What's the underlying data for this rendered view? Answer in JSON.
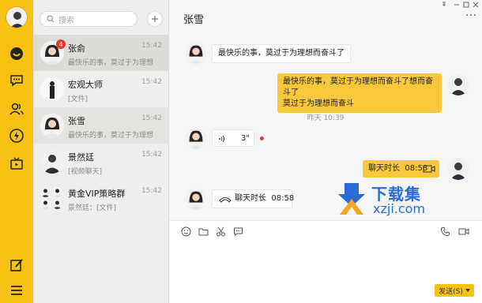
{
  "search": {
    "placeholder": "搜索"
  },
  "contacts": [
    {
      "name": "张俞",
      "time": "15:42",
      "preview": "最快乐的事，莫过于为理想",
      "badge": "4"
    },
    {
      "name": "宏观大师",
      "time": "15:42",
      "preview": "[文件]"
    },
    {
      "name": "张雪",
      "time": "15:42",
      "preview": "最快乐的事，莫过于为理想"
    },
    {
      "name": "景然廷",
      "time": "15:42",
      "preview": "[视频聊天]"
    },
    {
      "name": "黄金VIP策略群",
      "time": "15:42",
      "preview": "景然廷：[文件]"
    }
  ],
  "chat": {
    "title": "张雪",
    "messages": [
      {
        "dir": "in",
        "text": "最快乐的事，莫过于为理想而奋斗了"
      },
      {
        "dir": "out",
        "line1": "最快乐的事，莫过于为理想而奋斗了想而奋斗了",
        "line2": "莫过于为理想而奋斗"
      },
      {
        "timestamp": "昨天 10:39"
      },
      {
        "dir": "in",
        "voice_duration": "3\""
      },
      {
        "dir": "out",
        "text": "聊天时长  08:58"
      },
      {
        "dir": "in",
        "text": "聊天时长  08:58"
      }
    ]
  },
  "toolbar": {
    "icons": [
      "emoji-icon",
      "folder-icon",
      "scissors-icon",
      "chat-bubble-icon"
    ],
    "right_icons": [
      "phone-icon",
      "video-icon"
    ]
  },
  "send_button": {
    "label": "发送(S)"
  },
  "watermark": {
    "cn": "下载集",
    "en": "xzji.com"
  },
  "colors": {
    "accent": "#f8c215",
    "out_bubble": "#f9c83c",
    "badge": "#e8382f",
    "watermark": "#2a6bd6"
  }
}
